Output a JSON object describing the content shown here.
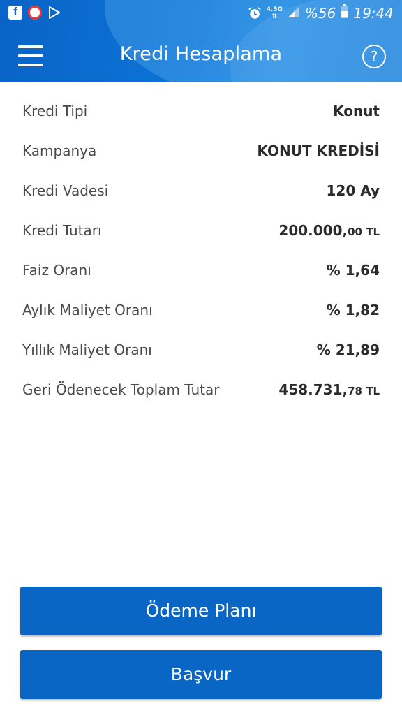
{
  "status_bar": {
    "left_icons": [
      "facebook-icon",
      "app-notification-icon",
      "play-store-icon"
    ],
    "network": "4.5G",
    "battery": "%56",
    "time": "19:44",
    "right_icons": [
      "alarm-icon",
      "data-arrows-icon",
      "signal-icon",
      "battery-icon"
    ]
  },
  "header": {
    "title": "Kredi Hesaplama",
    "menu_icon": "hamburger-menu-icon",
    "help_icon": "help-circle-icon",
    "help_symbol": "?"
  },
  "details": {
    "rows": [
      {
        "label": "Kredi Tipi",
        "value": "Konut"
      },
      {
        "label": "Kampanya",
        "value": "KONUT KREDİSİ"
      },
      {
        "label": "Kredi Vadesi",
        "value": "120 Ay"
      },
      {
        "label": "Kredi Tutarı",
        "value_main": "200.000,",
        "value_small": "00 TL"
      },
      {
        "label": "Faiz Oranı",
        "value": "% 1,64"
      },
      {
        "label": "Aylık Maliyet Oranı",
        "value": "% 1,82"
      },
      {
        "label": "Yıllık Maliyet Oranı",
        "value": "% 21,89"
      },
      {
        "label": "Geri Ödenecek Toplam Tutar",
        "value_main": "458.731,",
        "value_small": "78 TL"
      }
    ]
  },
  "actions": {
    "payment_plan_label": "Ödeme Planı",
    "apply_label": "Başvur"
  },
  "colors": {
    "header_blue": "#0c73d6",
    "button_blue": "#0a66c4",
    "label_gray": "#4a4a4a",
    "value_dark": "#2b2b2b"
  }
}
